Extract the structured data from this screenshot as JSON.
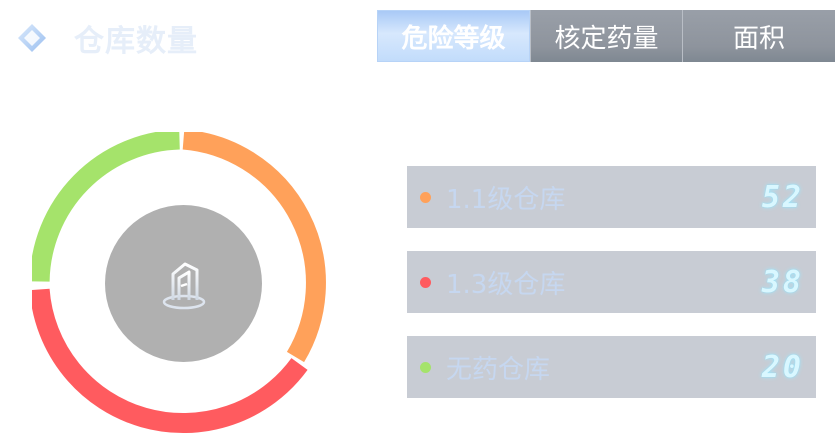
{
  "header": {
    "title": "仓库数量",
    "tabs": [
      {
        "label": "危险等级",
        "active": true
      },
      {
        "label": "核定药量",
        "active": false
      },
      {
        "label": "面积",
        "active": false
      }
    ]
  },
  "legend": [
    {
      "label": "1.1级仓库",
      "value": "52",
      "color": "#ffa15a"
    },
    {
      "label": "1.3级仓库",
      "value": "38",
      "color": "#ff5b5f"
    },
    {
      "label": "无药仓库",
      "value": "20",
      "color": "#a5e36b"
    }
  ],
  "colors": {
    "accent": "#a9c9f6",
    "series_1": "#ffa15a",
    "series_2": "#ff5b5f",
    "series_3": "#a5e36b"
  },
  "icons": {
    "title_icon": "diamond-icon",
    "center_icon": "warehouse-building-icon"
  }
}
